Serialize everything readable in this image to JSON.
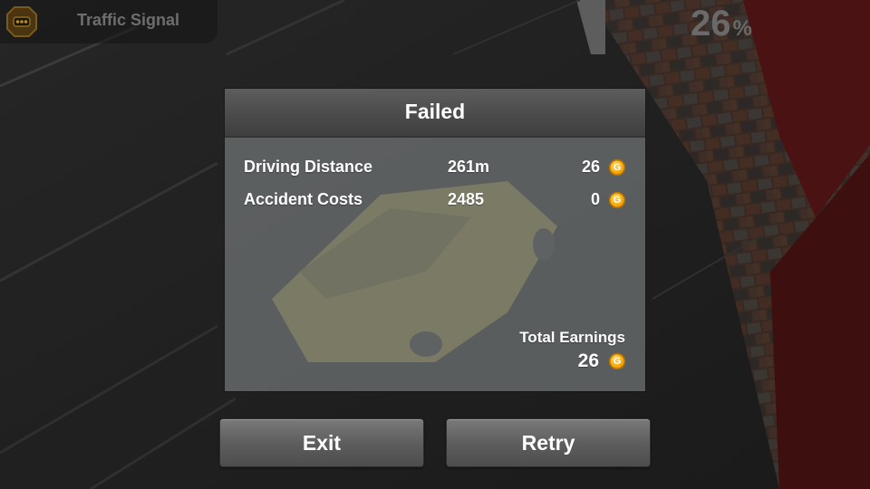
{
  "hud": {
    "mission_title": "Traffic Signal",
    "progress_value": "26",
    "progress_unit": "%",
    "menu_icon": "signal-icon"
  },
  "dialog": {
    "title": "Failed",
    "rows": [
      {
        "label": "Driving Distance",
        "value": "261m",
        "amount": "26",
        "icon": "coin-icon"
      },
      {
        "label": "Accident Costs",
        "value": "2485",
        "amount": "0",
        "icon": "coin-icon"
      }
    ],
    "total_label": "Total Earnings",
    "total_amount": "26",
    "coin_glyph": "G"
  },
  "buttons": {
    "exit_label": "Exit",
    "retry_label": "Retry"
  },
  "colors": {
    "coin": "#f4a400",
    "dialog_header": "#4b4b4b",
    "text": "#ffffff"
  }
}
